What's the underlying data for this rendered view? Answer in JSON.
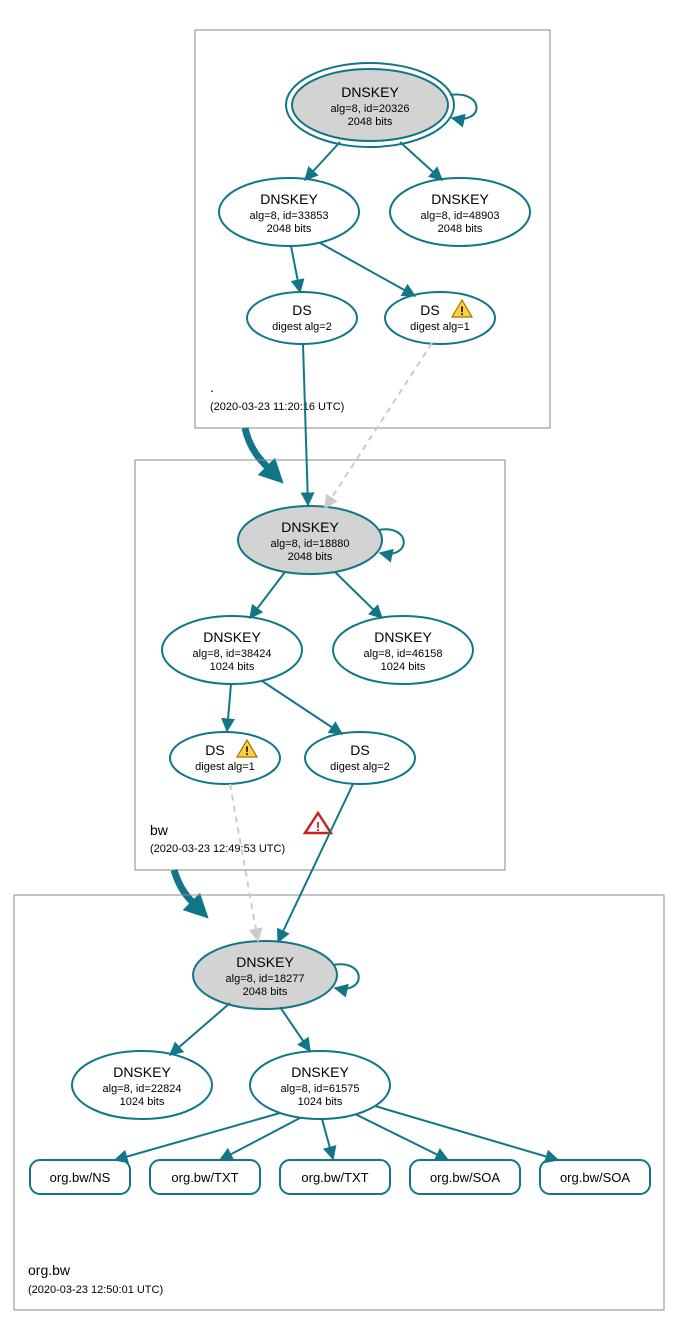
{
  "zones": {
    "root": {
      "label": ".",
      "timestamp": "(2020-03-23 11:20:16 UTC)"
    },
    "bw": {
      "label": "bw",
      "timestamp": "(2020-03-23 12:49:53 UTC)"
    },
    "orgbw": {
      "label": "org.bw",
      "timestamp": "(2020-03-23 12:50:01 UTC)"
    }
  },
  "nodes": {
    "root_ksk": {
      "title": "DNSKEY",
      "l1": "alg=8, id=20326",
      "l2": "2048 bits"
    },
    "root_zsk1": {
      "title": "DNSKEY",
      "l1": "alg=8, id=33853",
      "l2": "2048 bits"
    },
    "root_zsk2": {
      "title": "DNSKEY",
      "l1": "alg=8, id=48903",
      "l2": "2048 bits"
    },
    "root_ds1": {
      "title": "DS",
      "l1": "digest alg=2"
    },
    "root_ds2": {
      "title": "DS",
      "l1": "digest alg=1"
    },
    "bw_ksk": {
      "title": "DNSKEY",
      "l1": "alg=8, id=18880",
      "l2": "2048 bits"
    },
    "bw_zsk1": {
      "title": "DNSKEY",
      "l1": "alg=8, id=38424",
      "l2": "1024 bits"
    },
    "bw_zsk2": {
      "title": "DNSKEY",
      "l1": "alg=8, id=46158",
      "l2": "1024 bits"
    },
    "bw_ds1": {
      "title": "DS",
      "l1": "digest alg=1"
    },
    "bw_ds2": {
      "title": "DS",
      "l1": "digest alg=2"
    },
    "org_ksk": {
      "title": "DNSKEY",
      "l1": "alg=8, id=18277",
      "l2": "2048 bits"
    },
    "org_zsk1": {
      "title": "DNSKEY",
      "l1": "alg=8, id=22824",
      "l2": "1024 bits"
    },
    "org_zsk2": {
      "title": "DNSKEY",
      "l1": "alg=8, id=61575",
      "l2": "1024 bits"
    }
  },
  "rr": {
    "r1": "org.bw/NS",
    "r2": "org.bw/TXT",
    "r3": "org.bw/TXT",
    "r4": "org.bw/SOA",
    "r5": "org.bw/SOA"
  }
}
